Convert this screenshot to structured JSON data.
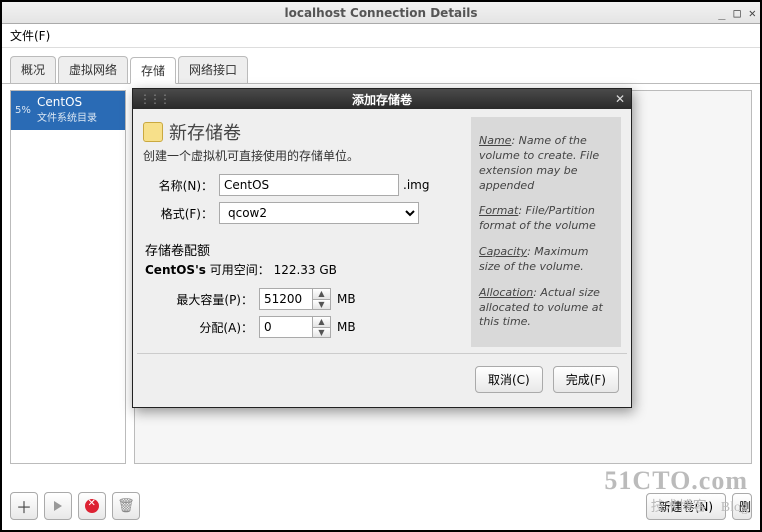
{
  "window": {
    "title": "localhost Connection Details"
  },
  "menu": {
    "file": "文件(F)"
  },
  "tabs": {
    "overview": "概况",
    "virtual_net": "虚拟网络",
    "storage": "存储",
    "net_iface": "网络接口"
  },
  "sidebar": {
    "percent": "5%",
    "pool_name": "CentOS",
    "pool_sub": "文件系统目录"
  },
  "toolbar": {
    "new_volume": "新建卷(N)",
    "delete_prefix": "删"
  },
  "dialog": {
    "title": "添加存储卷",
    "section_title": "新存储卷",
    "desc": "创建一个虚拟机可直接使用的存储单位。",
    "name_label": "名称(N)：",
    "name_value": "CentOS",
    "name_ext": ".img",
    "format_label": "格式(F)：",
    "format_value": "qcow2",
    "quota_head": "存储卷配额",
    "quota_pool": "CentOS's",
    "quota_avail_label": "可用空间：",
    "quota_avail_value": "122.33 GB",
    "max_label": "最大容量(P)：",
    "max_value": "51200",
    "alloc_label": "分配(A)：",
    "alloc_value": "0",
    "unit": "MB",
    "cancel": "取消(C)",
    "finish": "完成(F)"
  },
  "help": {
    "name_head": "Name",
    "name_body": ": Name of the volume to create. File extension may be appended",
    "format_head": "Format",
    "format_body": ": File/Partition format of the volume",
    "cap_head": "Capacity",
    "cap_body": ": Maximum size of the volume.",
    "alloc_head": "Allocation",
    "alloc_body": ": Actual size allocated to volume at this time."
  },
  "watermark": {
    "line1": "51CTO.com",
    "line2": "技术博客",
    "line3": "Blog"
  }
}
